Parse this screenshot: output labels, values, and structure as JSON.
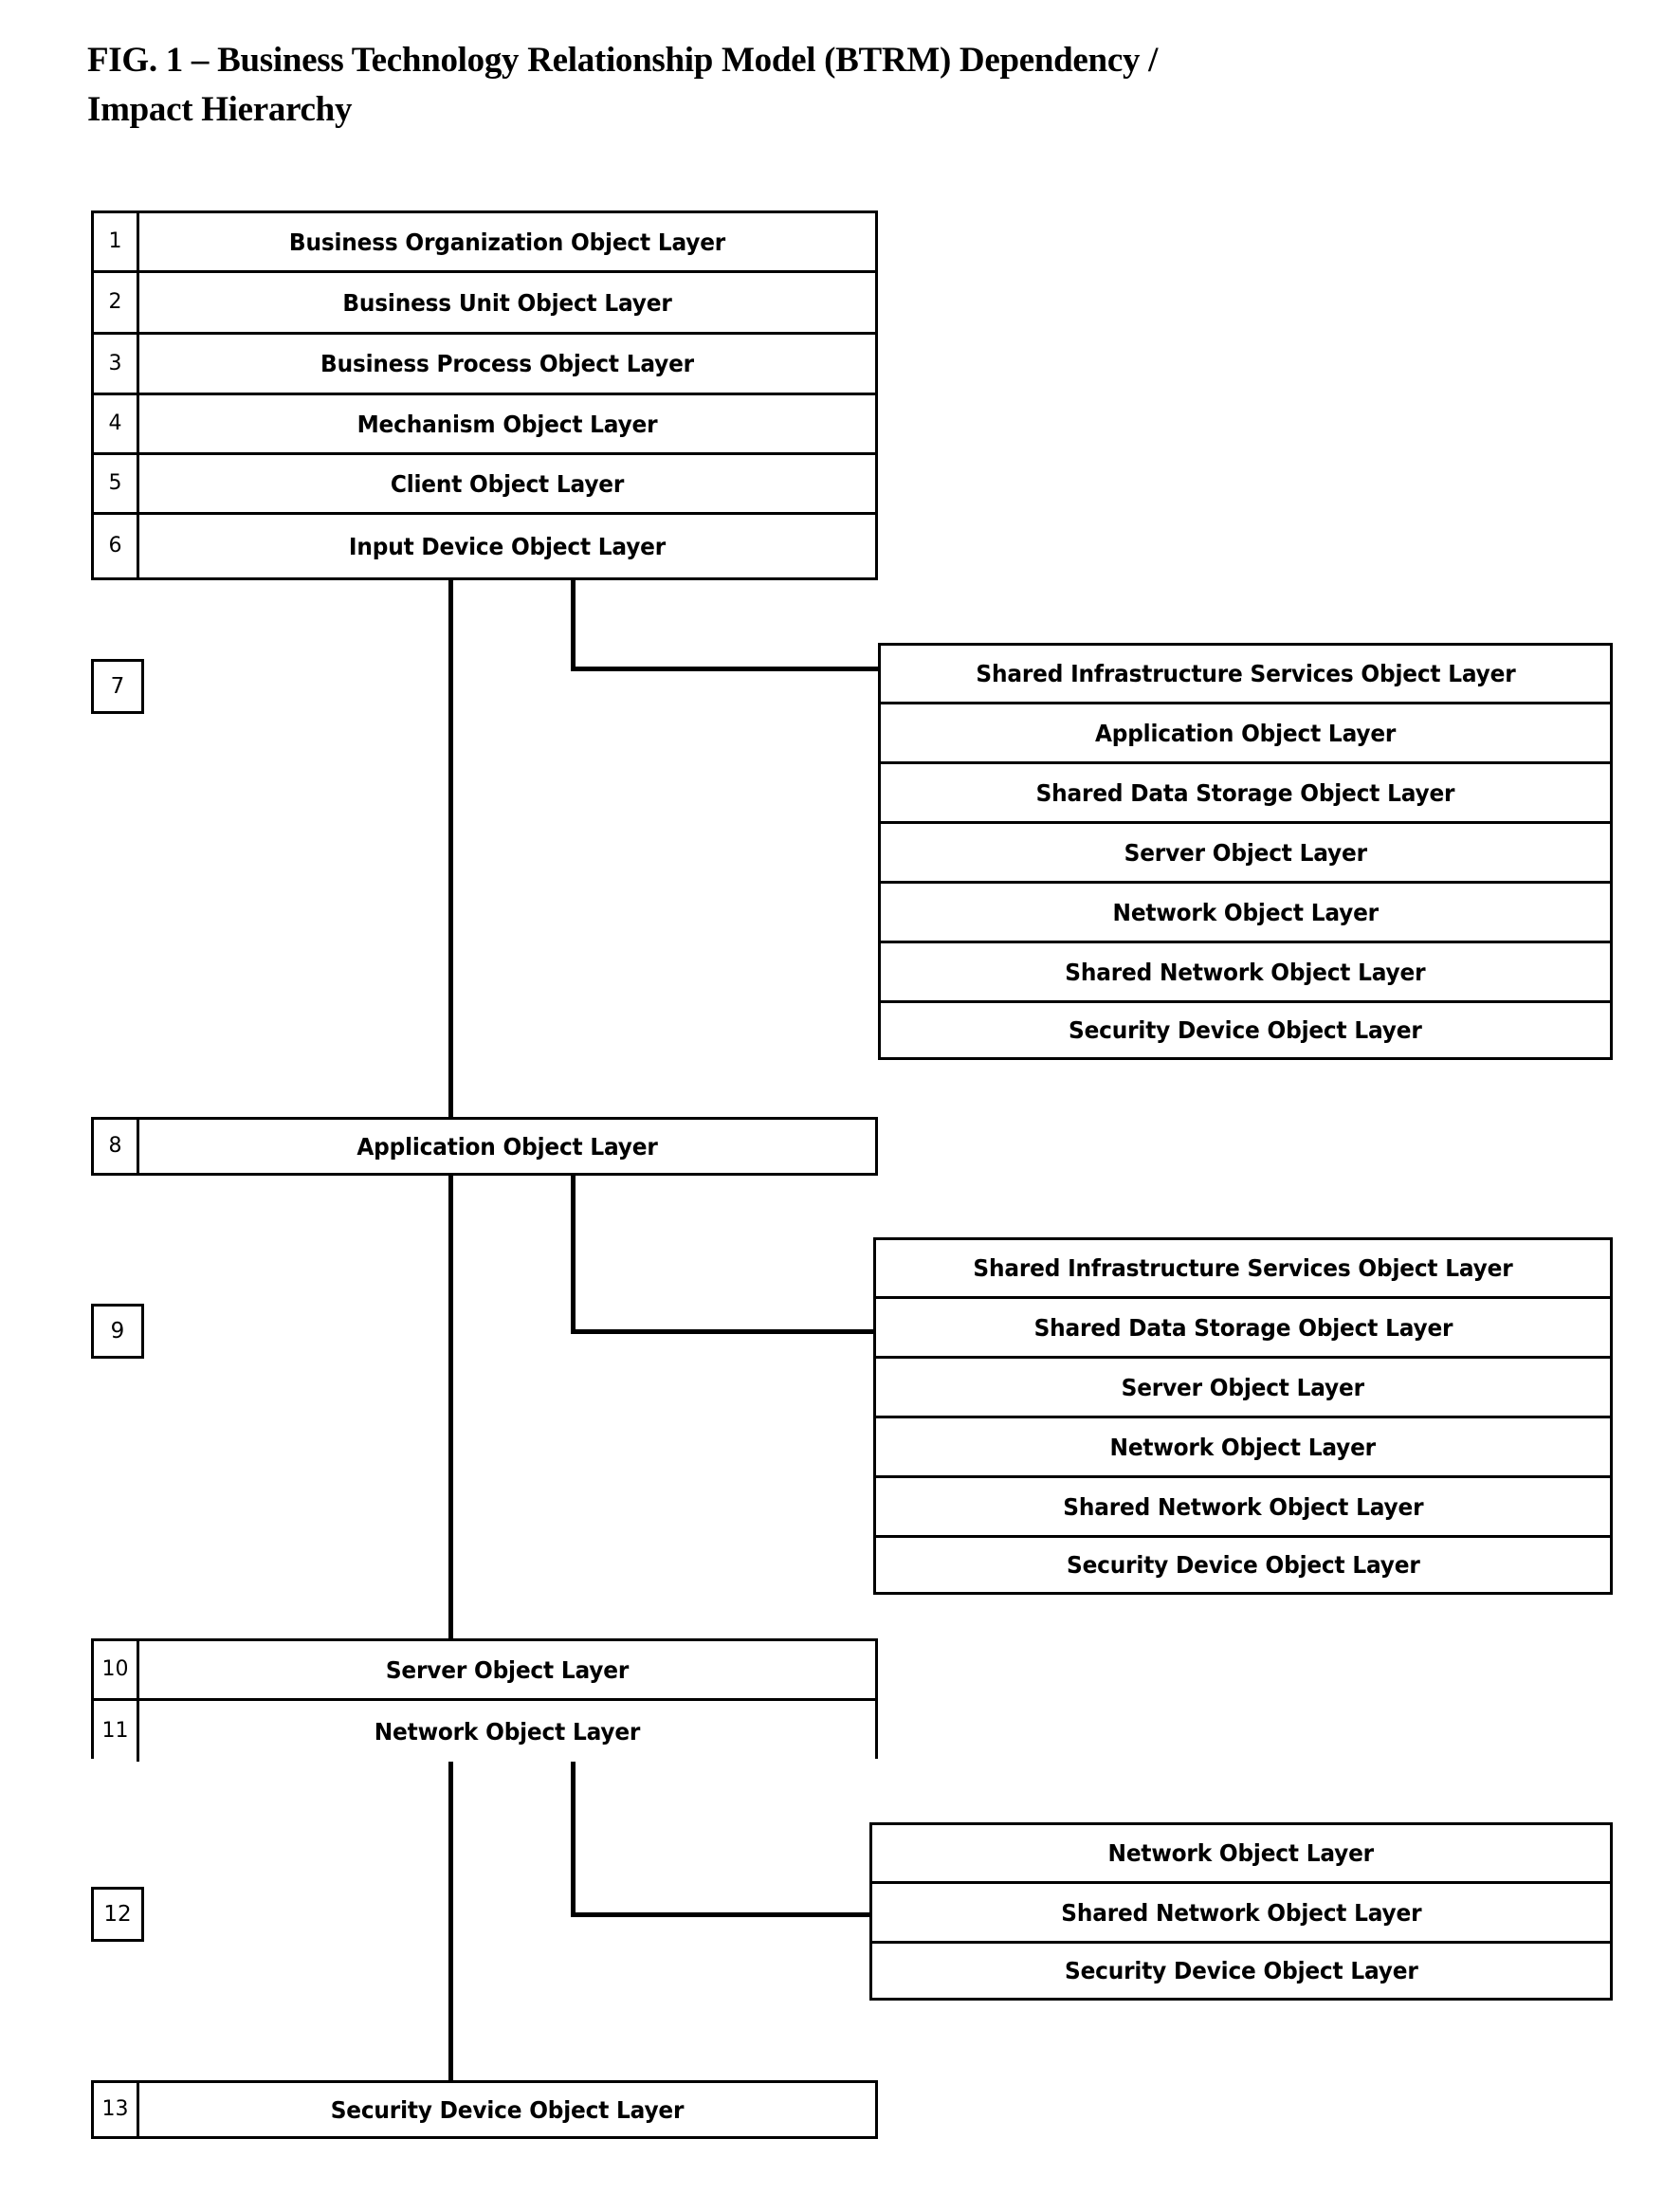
{
  "figure": {
    "title": "FIG. 1 – Business Technology Relationship Model (BTRM) Dependency / Impact Hierarchy",
    "title_line1": "FIG. 1 – Business Technology Relationship Model (BTRM) Dependency /",
    "title_line2": "Impact Hierarchy",
    "ink_color": "#000000",
    "background_color": "#ffffff"
  },
  "chart_data": {
    "type": "diagram",
    "title": "FIG. 1 – Business Technology Relationship Model (BTRM) Dependency / Impact Hierarchy",
    "description": "Vertical dependency / impact hierarchy of object layers with numbered callouts 1-13; left trunk column holds the primary numbered layers, right-hand stacks enumerate the dependent object layers branched from callouts 7, 9 and 12.",
    "nodes": [
      {
        "id": 1,
        "label": "Business Organization Object Layer",
        "column": "left"
      },
      {
        "id": 2,
        "label": "Business Unit Object Layer",
        "column": "left"
      },
      {
        "id": 3,
        "label": "Business Process Object Layer",
        "column": "left"
      },
      {
        "id": 4,
        "label": "Mechanism Object Layer",
        "column": "left"
      },
      {
        "id": 5,
        "label": "Client Object Layer",
        "column": "left"
      },
      {
        "id": 6,
        "label": "Input Device Object Layer",
        "column": "left"
      },
      {
        "id": 7,
        "label": "",
        "column": "callout"
      },
      {
        "id": 8,
        "label": "Application Object Layer",
        "column": "left"
      },
      {
        "id": 9,
        "label": "",
        "column": "callout"
      },
      {
        "id": 10,
        "label": "Server Object Layer",
        "column": "left"
      },
      {
        "id": 11,
        "label": "Network Object Layer",
        "column": "left"
      },
      {
        "id": 12,
        "label": "",
        "column": "callout"
      },
      {
        "id": 13,
        "label": "Security Device Object Layer",
        "column": "left"
      }
    ],
    "groups": [
      {
        "callout": 7,
        "items": [
          "Shared Infrastructure Services Object Layer",
          "Application Object Layer",
          "Shared Data Storage Object Layer",
          "Server Object Layer",
          "Network Object Layer",
          "Shared Network Object Layer",
          "Security Device Object Layer"
        ]
      },
      {
        "callout": 9,
        "items": [
          "Shared Infrastructure Services Object Layer",
          "Shared Data Storage Object Layer",
          "Server Object Layer",
          "Network Object Layer",
          "Shared Network Object Layer",
          "Security Device Object Layer"
        ]
      },
      {
        "callout": 12,
        "items": [
          "Network Object Layer",
          "Shared Network Object Layer",
          "Security Device Object Layer"
        ]
      }
    ]
  },
  "left_stack_1": {
    "rows": [
      {
        "num": "1",
        "label": "Business Organization Object Layer"
      },
      {
        "num": "2",
        "label": "Business Unit Object Layer"
      },
      {
        "num": "3",
        "label": "Business Process Object Layer"
      },
      {
        "num": "4",
        "label": "Mechanism Object Layer"
      },
      {
        "num": "5",
        "label": "Client Object Layer"
      },
      {
        "num": "6",
        "label": "Input Device Object Layer"
      }
    ]
  },
  "callout_7": {
    "num": "7"
  },
  "group_7": {
    "rows": [
      {
        "label": "Shared Infrastructure Services Object Layer"
      },
      {
        "label": "Application Object Layer"
      },
      {
        "label": "Shared Data Storage Object Layer"
      },
      {
        "label": "Server Object Layer"
      },
      {
        "label": "Network Object Layer"
      },
      {
        "label": "Shared Network Object Layer"
      },
      {
        "label": "Security Device Object Layer"
      }
    ]
  },
  "left_stack_8": {
    "rows": [
      {
        "num": "8",
        "label": "Application Object Layer"
      }
    ]
  },
  "callout_9": {
    "num": "9"
  },
  "group_9": {
    "rows": [
      {
        "label": "Shared Infrastructure Services Object Layer"
      },
      {
        "label": "Shared Data Storage Object Layer"
      },
      {
        "label": "Server Object Layer"
      },
      {
        "label": "Network Object Layer"
      },
      {
        "label": "Shared Network Object Layer"
      },
      {
        "label": "Security Device Object Layer"
      }
    ]
  },
  "left_stack_10": {
    "rows": [
      {
        "num": "10",
        "label": "Server Object Layer"
      },
      {
        "num": "11",
        "label": "Network Object Layer"
      }
    ]
  },
  "callout_12": {
    "num": "12"
  },
  "group_12": {
    "rows": [
      {
        "label": "Network Object Layer"
      },
      {
        "label": "Shared Network Object Layer"
      },
      {
        "label": "Security Device Object Layer"
      }
    ]
  },
  "left_stack_13": {
    "rows": [
      {
        "num": "13",
        "label": "Security Device Object Layer"
      }
    ]
  }
}
